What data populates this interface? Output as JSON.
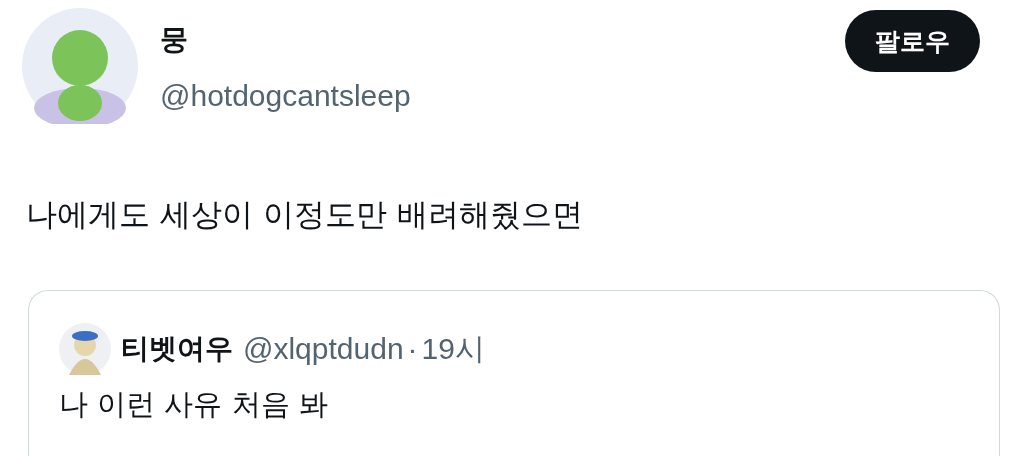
{
  "author": {
    "name": "뭉",
    "handle": "@hotdogcantsleep"
  },
  "follow_button": {
    "label": "팔로우"
  },
  "text": "나에게도 세상이 이정도만 배려해줬으면",
  "quoted": {
    "name": "티벳여우",
    "handle": "@xlqptdudn",
    "separator": "·",
    "time": "19시",
    "text": "나 이런 사유 처음 봐"
  }
}
